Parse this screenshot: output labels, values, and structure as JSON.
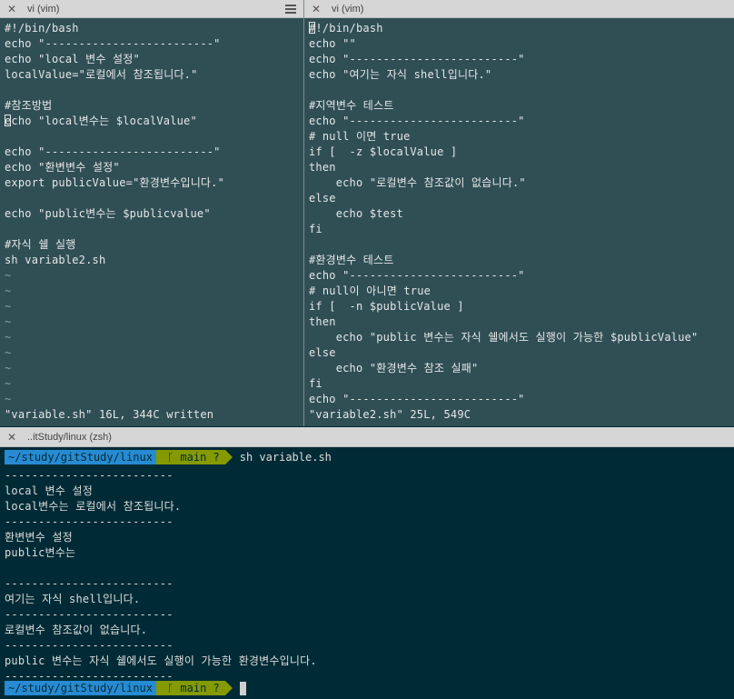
{
  "left_pane": {
    "tab_title": "vi (vim)",
    "lines": [
      "#!/bin/bash",
      "echo \"-------------------------\"",
      "echo \"local 변수 설정\"",
      "localValue=\"로컬에서 참조됩니다.\"",
      "",
      "#참조방법",
      "echo \"local변수는 $localValue\"",
      "",
      "echo \"-------------------------\"",
      "echo \"환변변수 설정\"",
      "export publicValue=\"환경변수입니다.\"",
      "",
      "echo \"public변수는 $publicvalue\"",
      "",
      "#자식 쉘 실행",
      "sh variable2.sh",
      "~",
      "~",
      "~",
      "~",
      "~",
      "~",
      "~",
      "~",
      "~",
      "\"variable.sh\" 16L, 344C written"
    ]
  },
  "right_pane": {
    "tab_title": "vi (vim)",
    "lines": [
      "#!/bin/bash",
      "echo \"\"",
      "echo \"-------------------------\"",
      "echo \"여기는 자식 shell입니다.\"",
      "",
      "#지역변수 테스트",
      "echo \"-------------------------\"",
      "# null 이면 true",
      "if [  -z $localValue ]",
      "then",
      "    echo \"로컬변수 참조값이 없습니다.\"",
      "else",
      "    echo $test",
      "fi",
      "",
      "#환경변수 테스트",
      "echo \"-------------------------\"",
      "# null이 아니면 true",
      "if [  -n $publicValue ]",
      "then",
      "    echo \"public 변수는 자식 쉘에서도 실행이 가능한 $publicValue\"",
      "else",
      "    echo \"환경변수 참조 실패\"",
      "fi",
      "echo \"-------------------------\"",
      "\"variable2.sh\" 25L, 549C"
    ]
  },
  "terminal": {
    "tab_title": "..itStudy/linux (zsh)",
    "prompt_path": "~/study/gitStudy/linux",
    "prompt_branch": "main ?",
    "command": "sh variable.sh",
    "output": [
      "-------------------------",
      "local 변수 설정",
      "local변수는 로컬에서 참조됩니다.",
      "-------------------------",
      "환변변수 설정",
      "public변수는",
      "",
      "-------------------------",
      "여기는 자식 shell입니다.",
      "-------------------------",
      "로컬변수 참조값이 없습니다.",
      "-------------------------",
      "public 변수는 자식 쉘에서도 실행이 가능한 환경변수입니다.",
      "-------------------------"
    ],
    "prompt2_path": "~/study/gitStudy/linux",
    "prompt2_branch": "main ?"
  },
  "colors": {
    "vim_bg": "#2f4f55",
    "term_bg": "#002b36",
    "prompt_path_bg": "#268bd2",
    "prompt_git_bg": "#859900"
  },
  "icons": {
    "tab_close": "close-icon",
    "pane_menu": "hamburger-menu-icon",
    "git_branch": "branch-icon"
  }
}
